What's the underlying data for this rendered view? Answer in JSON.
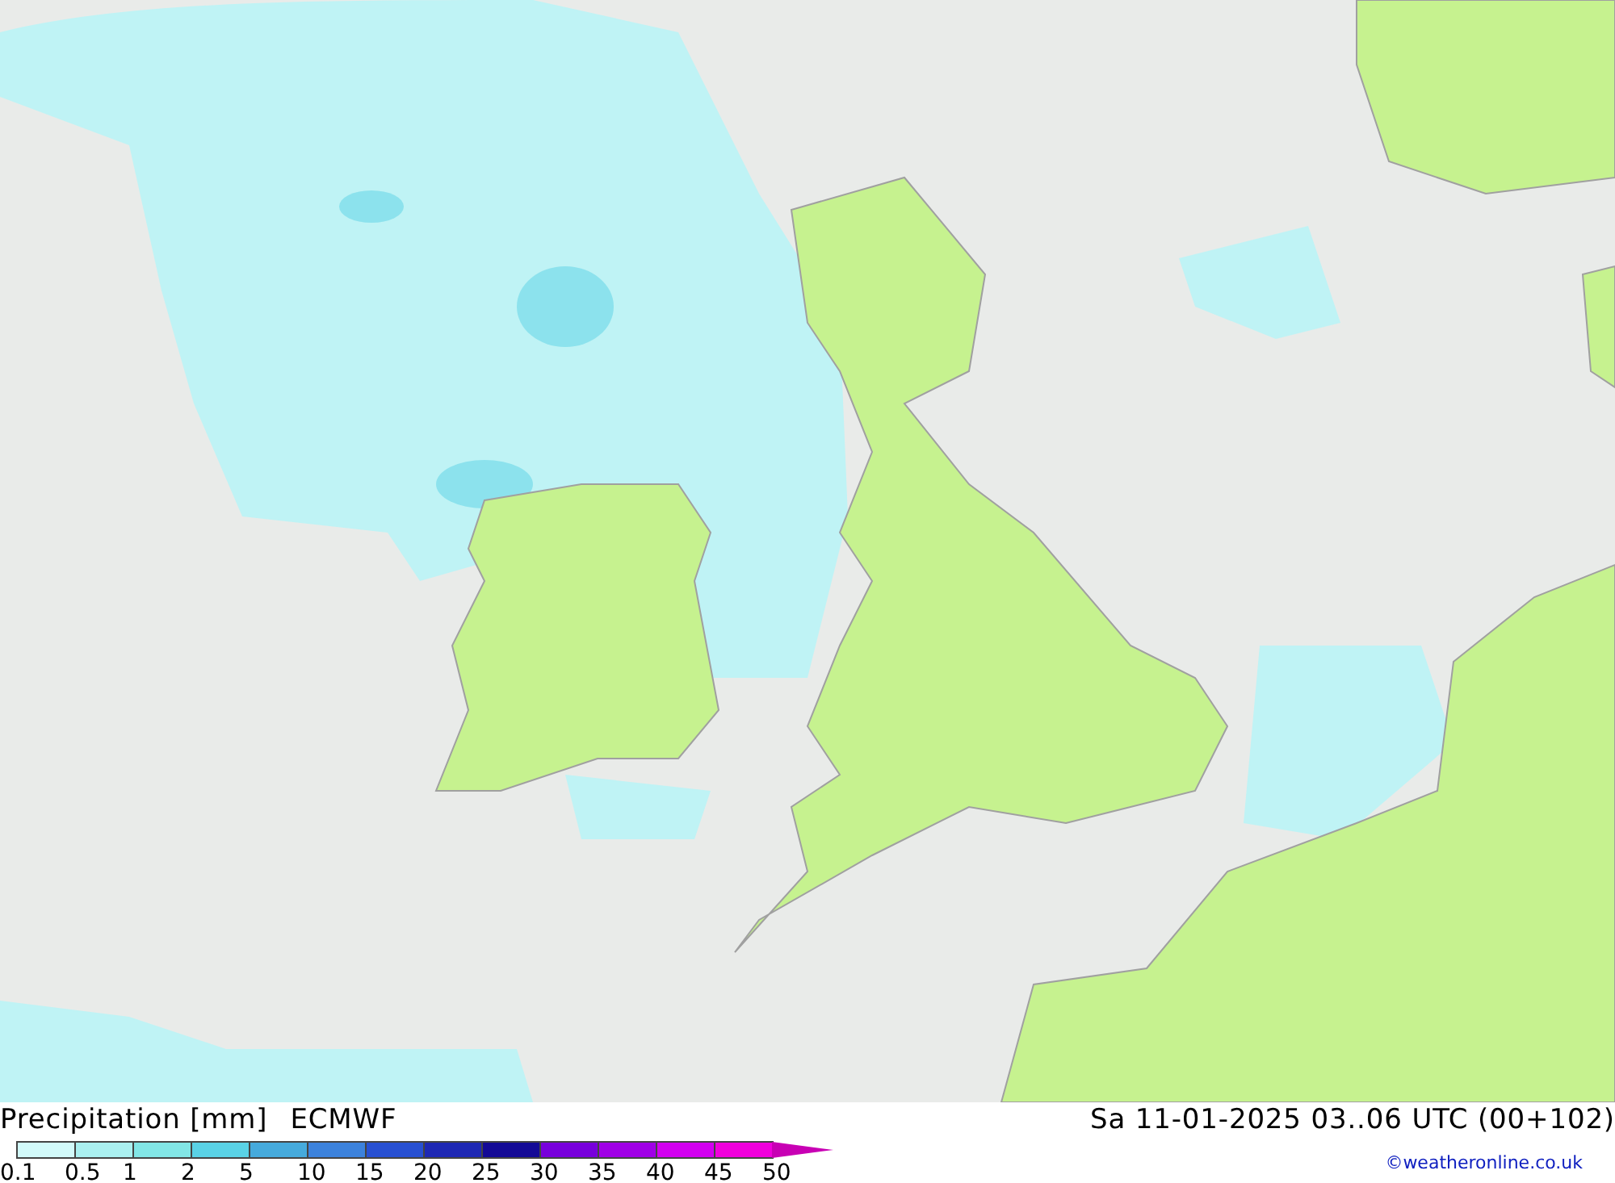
{
  "title": {
    "parameter": "Precipitation [mm]",
    "model": "ECMWF"
  },
  "valid_time": "Sa 11-01-2025 03..06 UTC (00+102)",
  "legend": {
    "classes": [
      {
        "color": "#d2fafa"
      },
      {
        "color": "#aaf0f0"
      },
      {
        "color": "#82e6e6"
      },
      {
        "color": "#5ad2e6"
      },
      {
        "color": "#46aadc"
      },
      {
        "color": "#3c82dc"
      },
      {
        "color": "#2850d2"
      },
      {
        "color": "#1e28b4"
      },
      {
        "color": "#140a96"
      },
      {
        "color": "#7800dc"
      },
      {
        "color": "#a000e6"
      },
      {
        "color": "#d200f0"
      },
      {
        "color": "#f000dc"
      },
      {
        "color": "#c800b4"
      }
    ],
    "labels": [
      "0.1",
      "0.5",
      "1",
      "2",
      "5",
      "10",
      "15",
      "20",
      "25",
      "30",
      "35",
      "40",
      "45",
      "50"
    ]
  },
  "credit": "©weatheronline.co.uk"
}
